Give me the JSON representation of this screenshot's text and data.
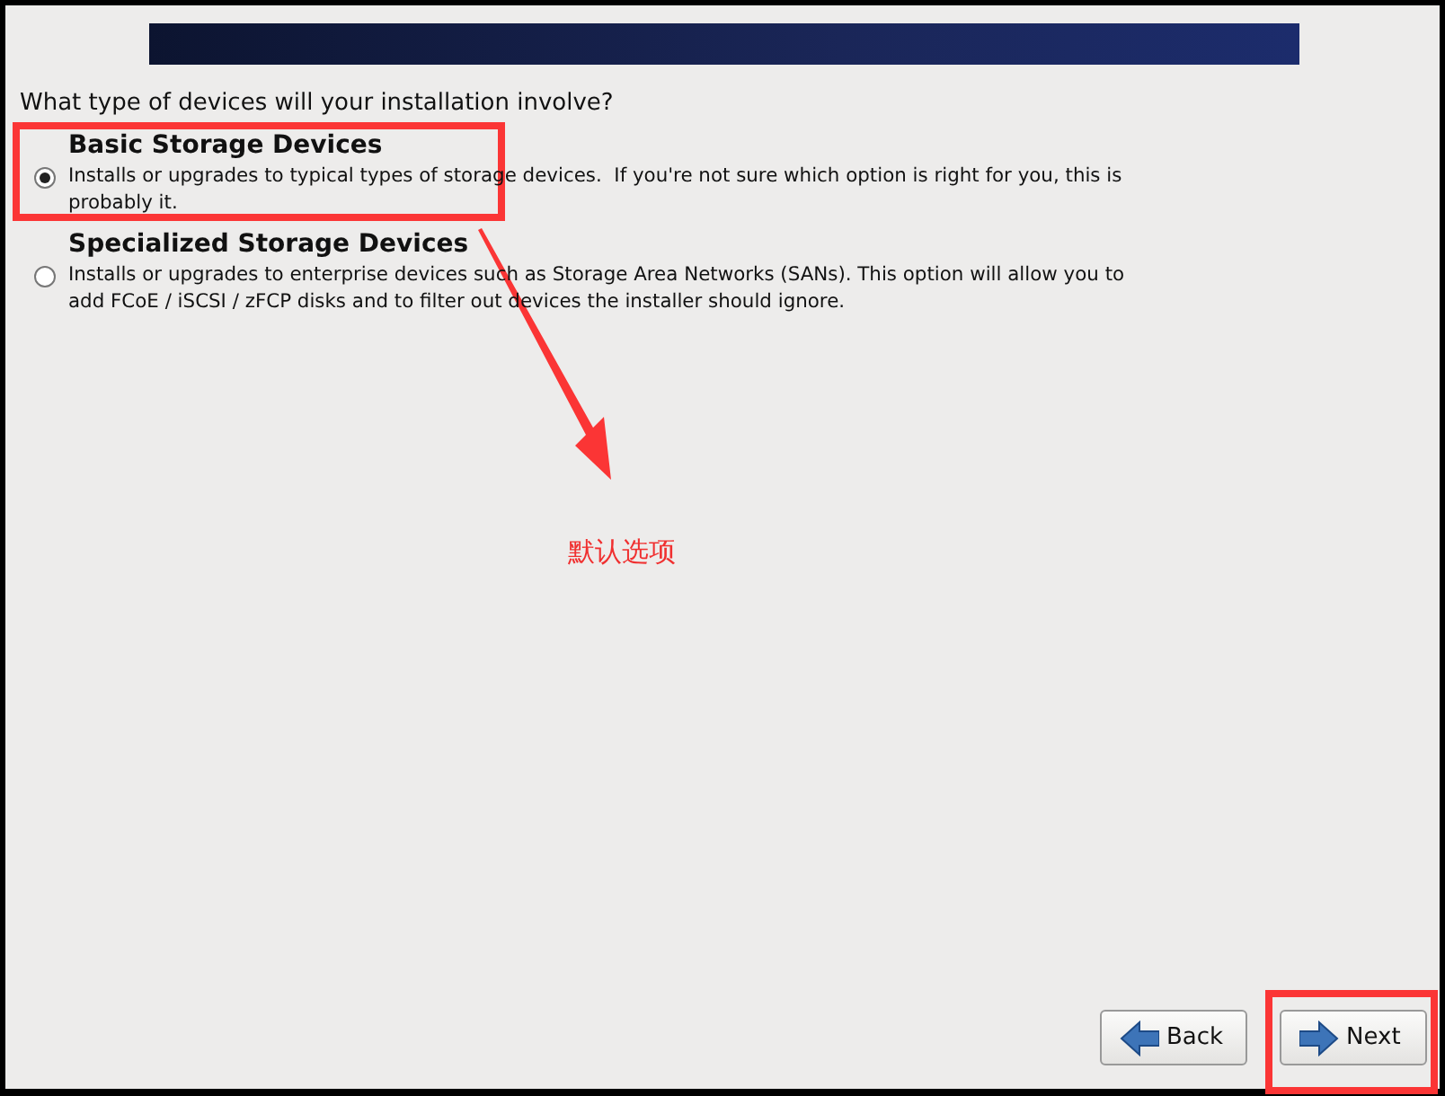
{
  "question": "What type of devices will your installation involve?",
  "options": [
    {
      "title": "Basic Storage Devices",
      "description": "Installs or upgrades to typical types of storage devices.  If you're not sure which option is right for you, this is probably it.",
      "selected": true
    },
    {
      "title": "Specialized Storage Devices",
      "description": "Installs or upgrades to enterprise devices such as Storage Area Networks (SANs). This option will allow you to add FCoE / iSCSI / zFCP disks and to filter out devices the installer should ignore.",
      "selected": false
    }
  ],
  "buttons": [
    {
      "label": "Back",
      "kind": "back"
    },
    {
      "label": "Next",
      "kind": "next"
    }
  ],
  "annotation": {
    "label": "默认选项"
  }
}
